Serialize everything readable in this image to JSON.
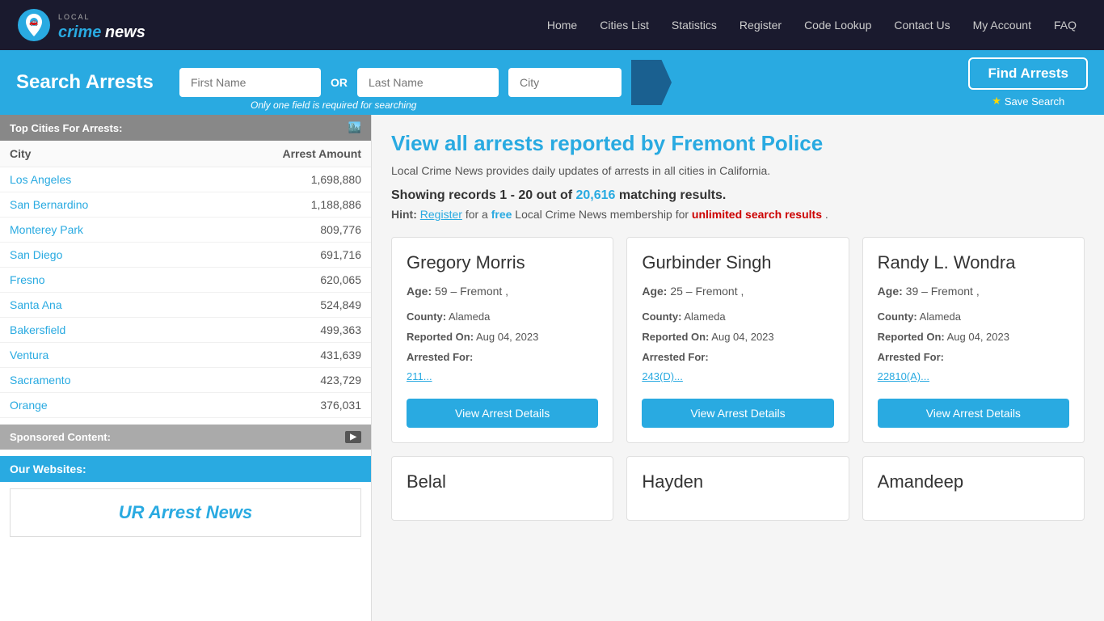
{
  "nav": {
    "links": [
      {
        "label": "Home",
        "name": "home"
      },
      {
        "label": "Cities List",
        "name": "cities-list"
      },
      {
        "label": "Statistics",
        "name": "statistics"
      },
      {
        "label": "Register",
        "name": "register"
      },
      {
        "label": "Code Lookup",
        "name": "code-lookup"
      },
      {
        "label": "Contact Us",
        "name": "contact-us"
      },
      {
        "label": "My Account",
        "name": "my-account"
      },
      {
        "label": "FAQ",
        "name": "faq"
      }
    ]
  },
  "logo": {
    "local": "LOCAL",
    "crime": "crime",
    "news": "news"
  },
  "search": {
    "title": "Search Arrests",
    "first_name_placeholder": "First Name",
    "last_name_placeholder": "Last Name",
    "city_placeholder": "City",
    "or_label": "OR",
    "hint": "Only one field is required for searching",
    "find_button": "Find Arrests",
    "save_search": "Save Search"
  },
  "sidebar": {
    "top_cities_header": "Top Cities For Arrests:",
    "columns": {
      "city": "City",
      "amount": "Arrest Amount"
    },
    "cities": [
      {
        "name": "Los Angeles",
        "amount": "1,698,880"
      },
      {
        "name": "San Bernardino",
        "amount": "1,188,886"
      },
      {
        "name": "Monterey Park",
        "amount": "809,776"
      },
      {
        "name": "San Diego",
        "amount": "691,716"
      },
      {
        "name": "Fresno",
        "amount": "620,065"
      },
      {
        "name": "Santa Ana",
        "amount": "524,849"
      },
      {
        "name": "Bakersfield",
        "amount": "499,363"
      },
      {
        "name": "Ventura",
        "amount": "431,639"
      },
      {
        "name": "Sacramento",
        "amount": "423,729"
      },
      {
        "name": "Orange",
        "amount": "376,031"
      }
    ],
    "sponsored_header": "Sponsored Content:",
    "our_websites_header": "Our Websites:",
    "ur_arrest_news_title": "UR Arrest News"
  },
  "main": {
    "heading": "View all arrests reported by Fremont Police",
    "description": "Local Crime News provides daily updates of arrests in all cities in California.",
    "records_showing": "Showing records ",
    "records_range": "1 - 20",
    "records_out": " out of ",
    "records_count": "20,616",
    "records_suffix": " matching results.",
    "hint_label": "Hint:",
    "hint_register": "Register",
    "hint_text1": " for a ",
    "hint_free": "free",
    "hint_text2": " Local Crime News membership for ",
    "hint_unlimited": "unlimited search results",
    "hint_end": "."
  },
  "arrests": [
    {
      "name": "Gregory Morris",
      "age": "59",
      "location": "Fremont ,",
      "county": "Alameda",
      "reported_on": "Aug 04, 2023",
      "arrested_for": "211...",
      "btn": "View Arrest Details"
    },
    {
      "name": "Gurbinder Singh",
      "age": "25",
      "location": "Fremont ,",
      "county": "Alameda",
      "reported_on": "Aug 04, 2023",
      "arrested_for": "243(D)...",
      "btn": "View Arrest Details"
    },
    {
      "name": "Randy L. Wondra",
      "age": "39",
      "location": "Fremont ,",
      "county": "Alameda",
      "reported_on": "Aug 04, 2023",
      "arrested_for": "22810(A)...",
      "btn": "View Arrest Details"
    }
  ],
  "partial_arrests": [
    {
      "name": "Belal"
    },
    {
      "name": "Hayden"
    },
    {
      "name": "Amandeep"
    }
  ],
  "labels": {
    "age": "Age:",
    "county": "County:",
    "reported_on": "Reported On:",
    "arrested_for": "Arrested For:"
  }
}
